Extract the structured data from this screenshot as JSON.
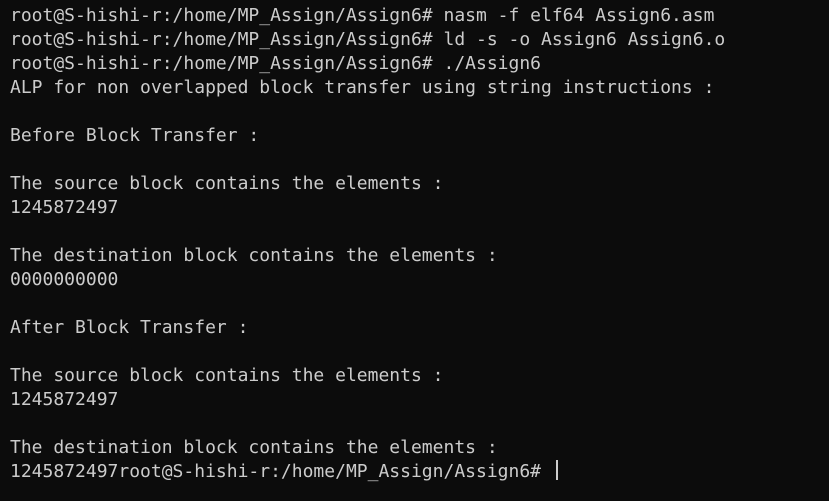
{
  "colors": {
    "background": "#0c0c0c",
    "text": "#cccccc"
  },
  "terminal": {
    "lines": [
      "root@S-hishi-r:/home/MP_Assign/Assign6# nasm -f elf64 Assign6.asm",
      "root@S-hishi-r:/home/MP_Assign/Assign6# ld -s -o Assign6 Assign6.o",
      "root@S-hishi-r:/home/MP_Assign/Assign6# ./Assign6",
      "ALP for non overlapped block transfer using string instructions :",
      "",
      "Before Block Transfer :",
      "",
      "The source block contains the elements :",
      "1245872497",
      "",
      "The destination block contains the elements :",
      "0000000000",
      "",
      "After Block Transfer :",
      "",
      "The source block contains the elements :",
      "1245872497",
      "",
      "The destination block contains the elements :",
      "1245872497root@S-hishi-r:/home/MP_Assign/Assign6# "
    ]
  }
}
